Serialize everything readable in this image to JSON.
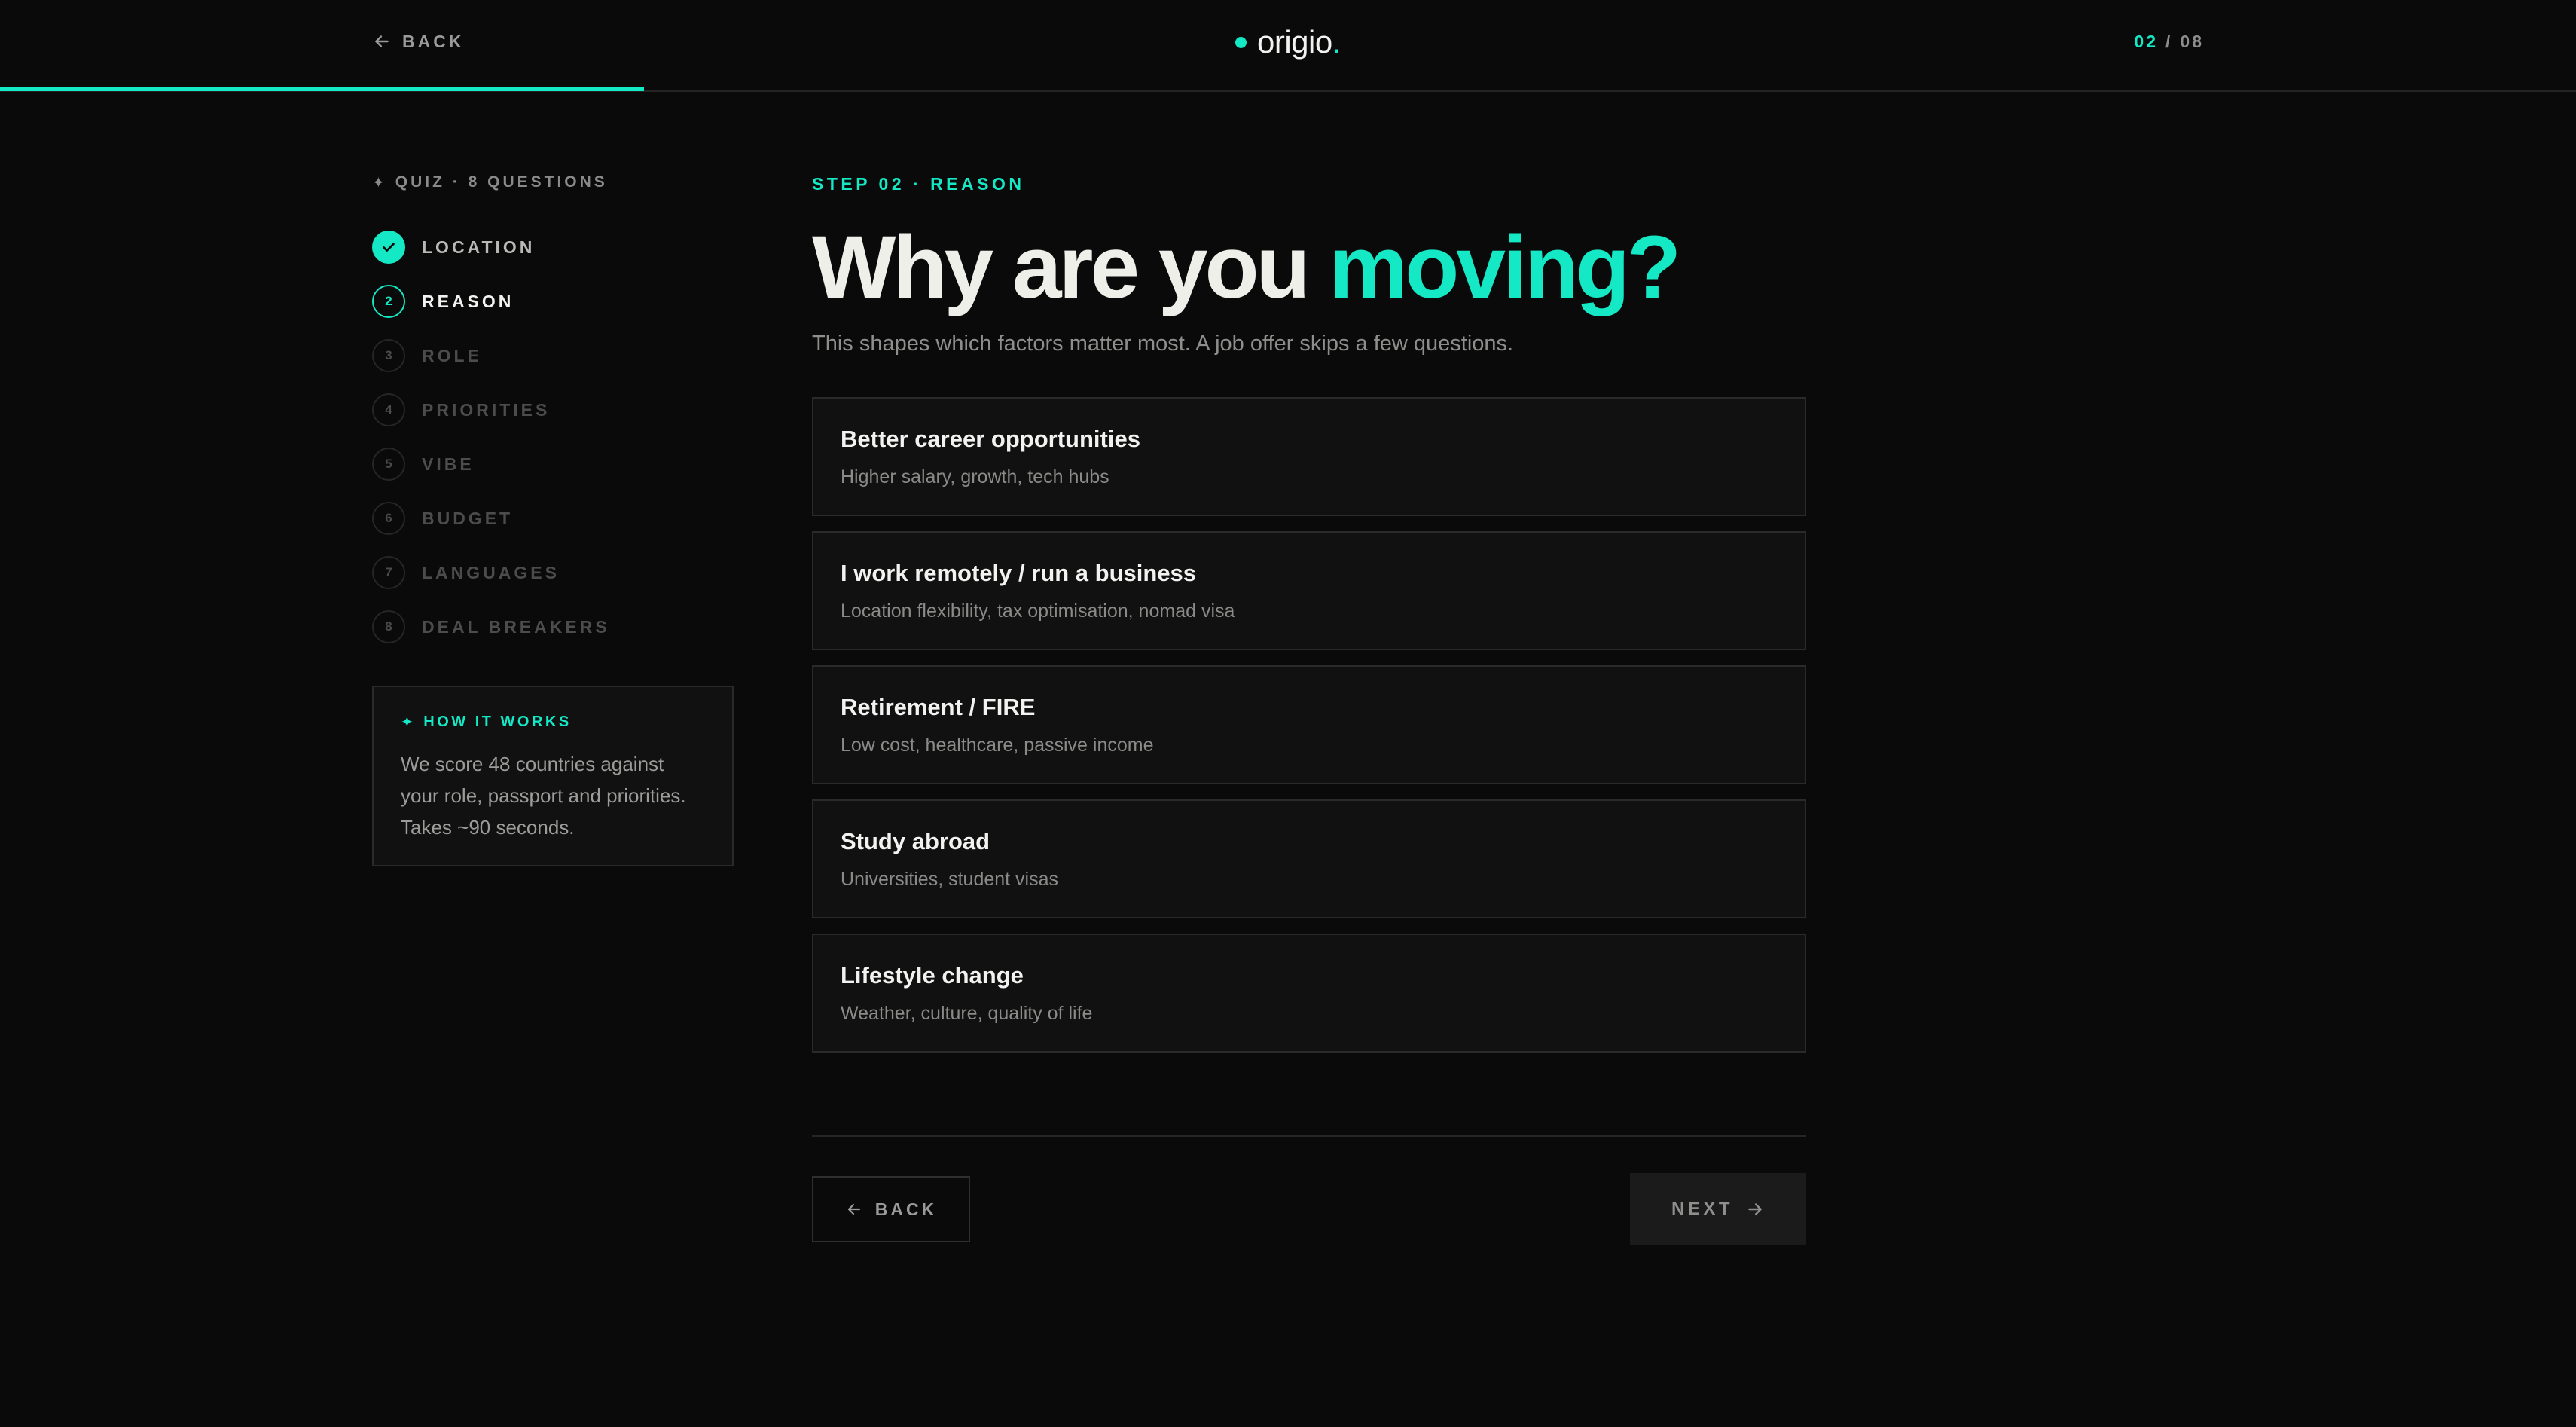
{
  "header": {
    "back_label": "BACK",
    "logo_name": "origio",
    "logo_dot": ".",
    "counter_current": "02",
    "counter_sep": "/",
    "counter_total": "08",
    "progress_fraction": 0.25,
    "accent_color": "#14e8c4"
  },
  "sidebar": {
    "quiz_label": "QUIZ · 8 QUESTIONS",
    "steps": [
      {
        "num": "1",
        "label": "LOCATION",
        "state": "done"
      },
      {
        "num": "2",
        "label": "REASON",
        "state": "active"
      },
      {
        "num": "3",
        "label": "ROLE",
        "state": "upcoming"
      },
      {
        "num": "4",
        "label": "PRIORITIES",
        "state": "upcoming"
      },
      {
        "num": "5",
        "label": "VIBE",
        "state": "upcoming"
      },
      {
        "num": "6",
        "label": "BUDGET",
        "state": "upcoming"
      },
      {
        "num": "7",
        "label": "LANGUAGES",
        "state": "upcoming"
      },
      {
        "num": "8",
        "label": "DEAL BREAKERS",
        "state": "upcoming"
      }
    ],
    "how_title": "HOW IT WORKS",
    "how_text": "We score 48 countries against your role, passport and priorities. Takes ~90 seconds."
  },
  "main": {
    "kicker": "STEP 02 · REASON",
    "headline_start": "Why are you ",
    "headline_accent": "moving?",
    "subtitle": "This shapes which factors matter most. A job offer skips a few questions.",
    "options": [
      {
        "title": "Better career opportunities",
        "desc": "Higher salary, growth, tech hubs"
      },
      {
        "title": "I work remotely / run a business",
        "desc": "Location flexibility, tax optimisation, nomad visa"
      },
      {
        "title": "Retirement / FIRE",
        "desc": "Low cost, healthcare, passive income"
      },
      {
        "title": "Study abroad",
        "desc": "Universities, student visas"
      },
      {
        "title": "Lifestyle change",
        "desc": "Weather, culture, quality of life"
      }
    ],
    "back_label": "BACK",
    "next_label": "NEXT"
  },
  "icons": {
    "back": "arrow-left-icon",
    "next": "arrow-right-icon",
    "check": "check-icon",
    "sparkle": "sparkle-icon"
  }
}
